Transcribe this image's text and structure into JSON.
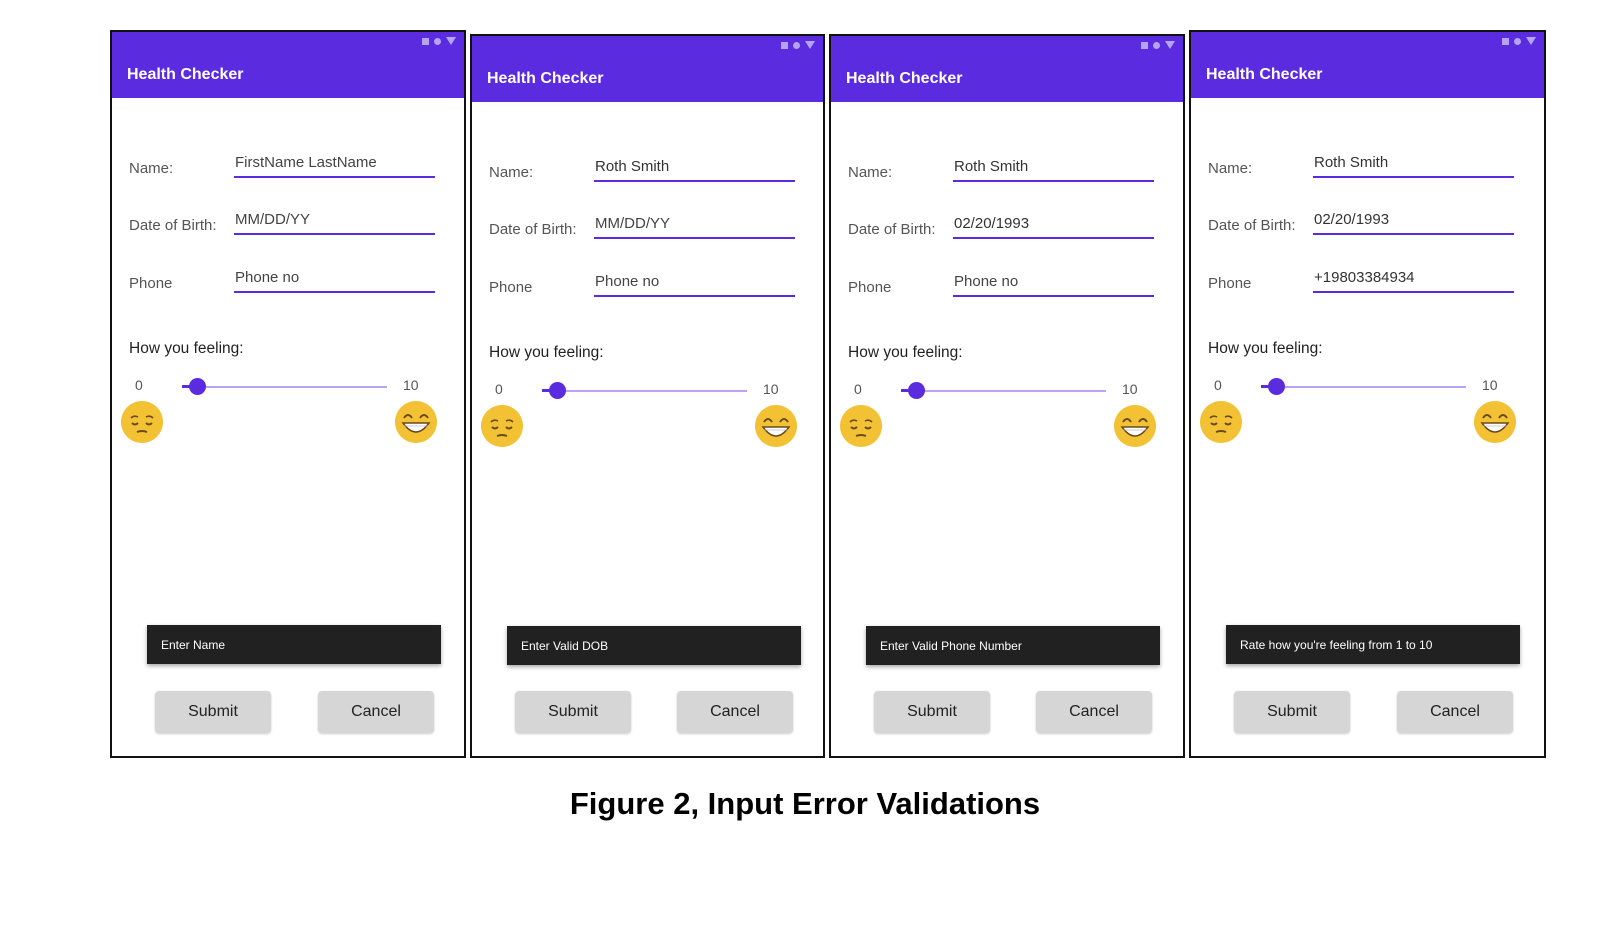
{
  "figure_caption": "Figure 2, Input Error Validations",
  "screens": [
    {
      "title": "Health Checker",
      "name_label": "Name:",
      "name_value": "FirstName LastName",
      "dob_label": "Date of Birth:",
      "dob_value": "MM/DD/YY",
      "phone_label": "Phone",
      "phone_value": "Phone no",
      "feeling_label": "How you feeling:",
      "slider_min": "0",
      "slider_max": "10",
      "slider_value": 0,
      "toast": "Enter Name",
      "submit": "Submit",
      "cancel": "Cancel"
    },
    {
      "title": "Health Checker",
      "name_label": "Name:",
      "name_value": "Roth Smith",
      "dob_label": "Date of Birth:",
      "dob_value": "MM/DD/YY",
      "phone_label": "Phone",
      "phone_value": "Phone no",
      "feeling_label": "How you feeling:",
      "slider_min": "0",
      "slider_max": "10",
      "slider_value": 0,
      "toast": "Enter Valid DOB",
      "submit": "Submit",
      "cancel": "Cancel"
    },
    {
      "title": "Health Checker",
      "name_label": "Name:",
      "name_value": "Roth Smith",
      "dob_label": "Date of Birth:",
      "dob_value": "02/20/1993",
      "phone_label": "Phone",
      "phone_value": "Phone no",
      "feeling_label": "How you feeling:",
      "slider_min": "0",
      "slider_max": "10",
      "slider_value": 0,
      "toast": "Enter Valid Phone Number",
      "submit": "Submit",
      "cancel": "Cancel"
    },
    {
      "title": "Health Checker",
      "name_label": "Name:",
      "name_value": "Roth Smith",
      "dob_label": "Date of Birth:",
      "dob_value": "02/20/1993",
      "phone_label": "Phone",
      "phone_value": "+19803384934",
      "feeling_label": "How you feeling:",
      "slider_min": "0",
      "slider_max": "10",
      "slider_value": 0,
      "toast": "Rate how you're feeling from 1 to 10",
      "submit": "Submit",
      "cancel": "Cancel"
    }
  ],
  "colors": {
    "app_bar": "#5b2be0",
    "slider_track": "#b9a4f5",
    "toast_bg": "#212121",
    "button_bg": "#d6d6d6",
    "emoji": "#f3c234"
  },
  "icons": [
    "status-square-icon",
    "status-circle-icon",
    "status-triangle-icon",
    "sad-face-emoji-icon",
    "grinning-face-emoji-icon"
  ]
}
